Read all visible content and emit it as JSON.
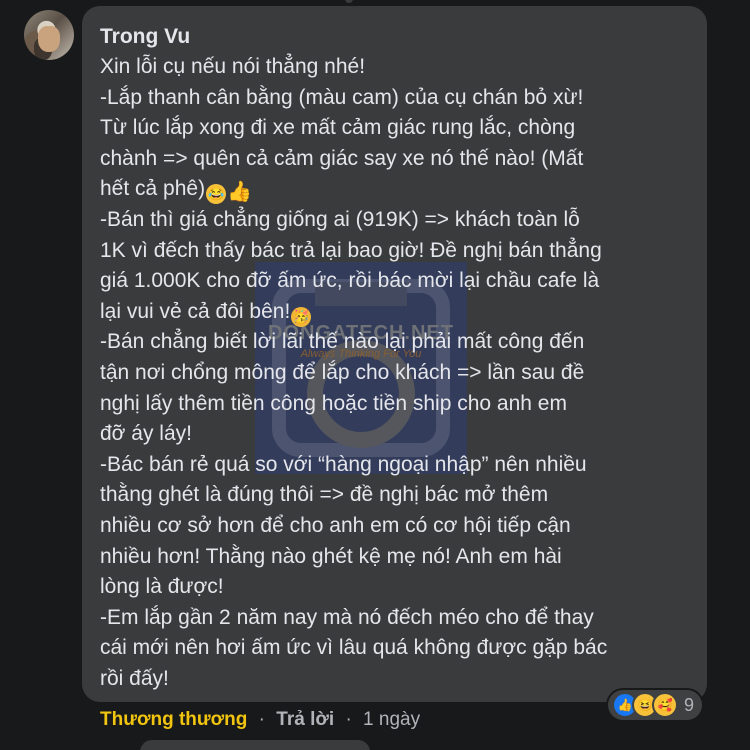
{
  "comment": {
    "author": "Trong Vu",
    "lines": [
      "Xin lỗi cụ nếu nói thẳng nhé!",
      "-Lắp thanh cân bằng (màu cam) của cụ chán bỏ xừ!",
      "Từ lúc lắp xong đi xe mất cảm giác rung lắc, chòng",
      "chành => quên cả cảm giác say xe nó thế nào! (Mất",
      "hết cả phê)",
      "-Bán thì giá chẳng giống ai (919K) => khách toàn lỗ",
      "1K vì đếch thấy bác trả lại bao giờ! Đề nghị bán thẳng",
      "giá 1.000K cho đỡ ấm ức, rồi bác mời lại chầu cafe là",
      "lại vui vẻ cả đôi bên!",
      "-Bán chẳng biết lời lãi thế nào lại phải mất công đến",
      "tận nơi chổng mông để lắp cho khách => lần sau đề",
      "nghị lấy thêm tiền công hoặc tiền ship cho anh em",
      "đỡ áy láy!",
      "-Bác bán rẻ quá so với “hàng ngoại nhập” nên nhiều",
      "thằng ghét là đúng thôi => đề nghị bác mở thêm",
      "nhiều cơ sở hơn để cho anh em có cơ hội tiếp cận",
      "nhiều hơn! Thằng nào ghét kệ mẹ nó! Anh em hài",
      "lòng là được!",
      "-Em lắp gần 2 năm nay mà nó đếch méo cho để thay",
      "cái mới nên hơi ấm ức vì lâu quá không được gặp bác",
      "rồi đấy!"
    ],
    "inline_emojis": {
      "line4": [
        "rolling-laugh-emoji",
        "thumbs-up-emoji"
      ],
      "line8": [
        "party-face-emoji"
      ]
    }
  },
  "watermark": {
    "brand": "DONGATECH.NET",
    "slogan": "Always Thinking For You"
  },
  "reactions": {
    "icons": [
      "like-icon",
      "haha-icon",
      "care-icon"
    ],
    "count": "9"
  },
  "footer": {
    "reply_author": "Thương thương",
    "separator": "·",
    "reply_label": "Trả lời",
    "time": "1 ngày"
  },
  "colors": {
    "background": "#18191a",
    "bubble": "#3a3b3c",
    "text": "#e4e6eb",
    "muted": "#b0b3b8",
    "reply_author": "#f1c40f",
    "like_blue": "#1877f2"
  }
}
